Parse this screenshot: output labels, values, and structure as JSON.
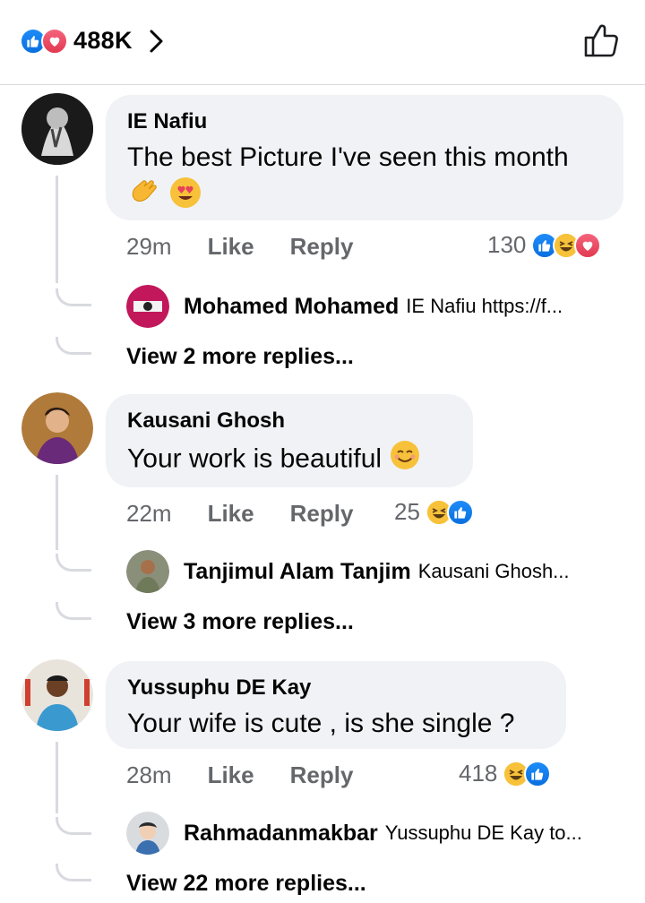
{
  "header": {
    "reaction_count": "488K",
    "reaction_icons": [
      "like-icon",
      "love-icon"
    ],
    "chevron_icon": "chevron-right-icon",
    "like_button_icon": "thumbs-up-outline-icon"
  },
  "comments": [
    {
      "author": "IE Nafiu",
      "text": "The best Picture I've seen this month",
      "emojis": [
        "clapping-hands-emoji",
        "heart-eyes-emoji"
      ],
      "time": "29m",
      "like_label": "Like",
      "reply_label": "Reply",
      "reaction_count": "130",
      "reaction_icons": [
        "like-icon",
        "haha-icon",
        "love-icon"
      ],
      "reply": {
        "name": "Mohamed Mohamed",
        "snippet": "IE Nafiu https://f..."
      },
      "view_more": "View 2 more replies..."
    },
    {
      "author": "Kausani Ghosh",
      "text": "Your work is beautiful",
      "emojis": [
        "smiling-emoji"
      ],
      "time": "22m",
      "like_label": "Like",
      "reply_label": "Reply",
      "reaction_count": "25",
      "reaction_icons": [
        "haha-icon",
        "like-icon"
      ],
      "reply": {
        "name": "Tanjimul Alam Tanjim",
        "snippet": "Kausani Ghosh..."
      },
      "view_more": "View 3 more replies..."
    },
    {
      "author": "Yussuphu DE Kay",
      "text": "Your wife is cute , is she single ?",
      "time": "28m",
      "like_label": "Like",
      "reply_label": "Reply",
      "reaction_count": "418",
      "reaction_icons": [
        "haha-icon",
        "like-icon"
      ],
      "reply": {
        "name": "Rahmadanmakbar",
        "snippet": "Yussuphu DE Kay to..."
      },
      "view_more": "View 22 more replies..."
    }
  ],
  "colors": {
    "like_blue": "#1877f2",
    "love_red": "#e8415a",
    "haha_yellow": "#f7c23a",
    "bubble_bg": "#f0f2f5",
    "meta_gray": "#65676b"
  }
}
